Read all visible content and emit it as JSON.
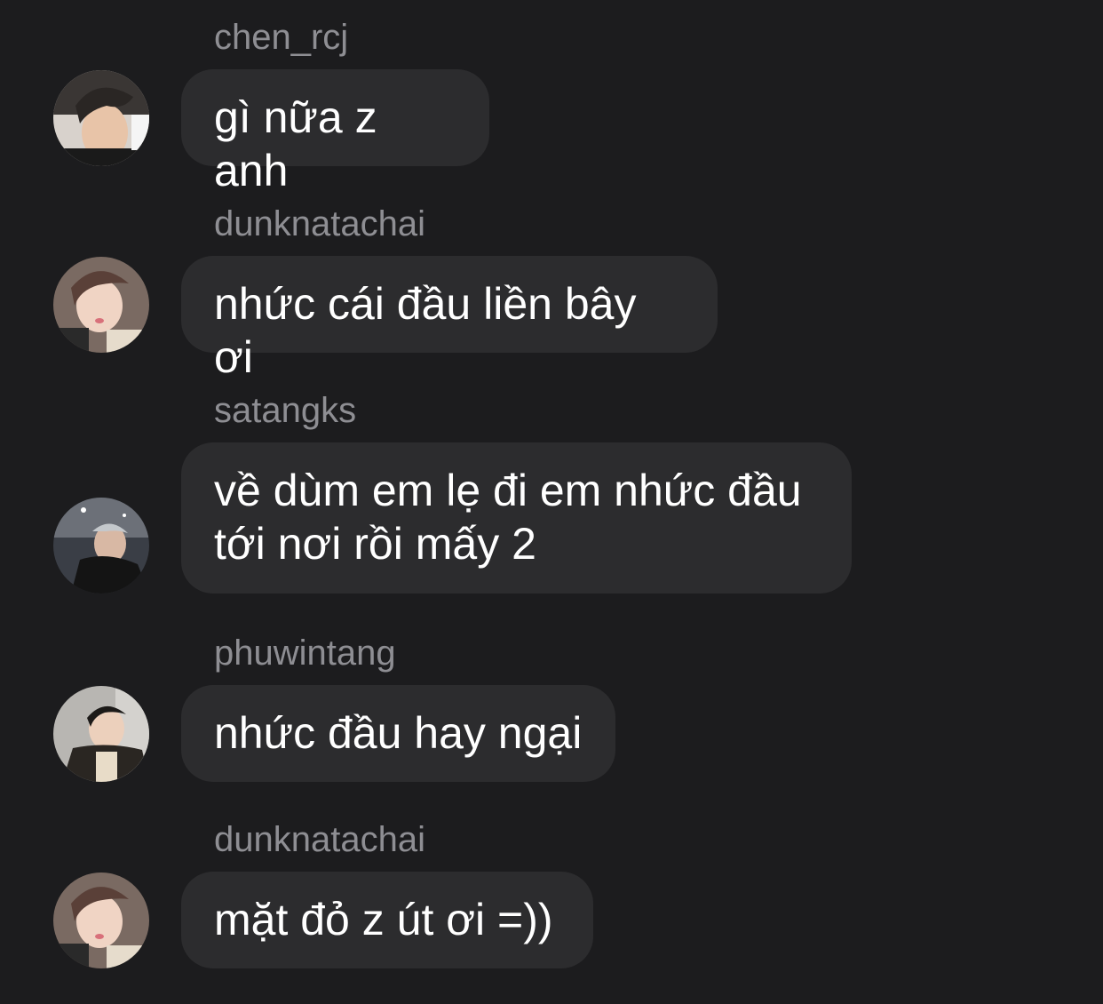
{
  "messages": [
    {
      "username": "chen_rcj",
      "text": "gì nữa z anh",
      "avatar": "avatar-chen-rcj"
    },
    {
      "username": "dunknatachai",
      "text": "nhức cái đầu liền bây ơi",
      "avatar": "avatar-dunknatachai"
    },
    {
      "username": "satangks",
      "text": "về dùm em lẹ đi em nhức đầu\ntới nơi rồi mấy 2",
      "avatar": "avatar-satangks"
    },
    {
      "username": "phuwintang",
      "text": "nhức đầu hay ngại",
      "avatar": "avatar-phuwintang"
    },
    {
      "username": "dunknatachai",
      "text": "mặt đỏ z út ơi =))",
      "avatar": "avatar-dunknatachai"
    }
  ],
  "colors": {
    "background": "#1c1c1e",
    "bubble": "#2c2c2e",
    "username": "#8e8e93",
    "message_text": "#ffffff"
  }
}
